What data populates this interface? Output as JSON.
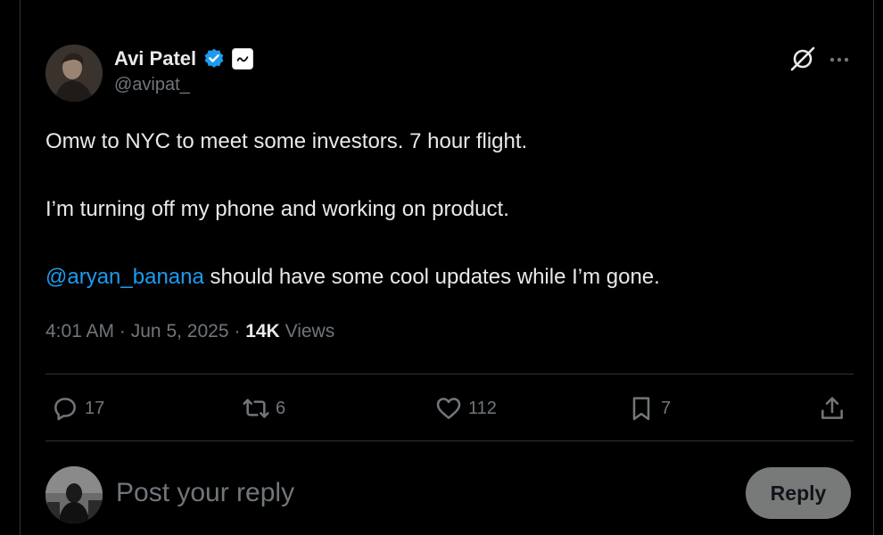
{
  "author": {
    "display_name": "Avi Patel",
    "handle": "@avipat_",
    "verified_color": "#1d9bf0"
  },
  "tweet": {
    "line1": "Omw to NYC to meet some investors. 7 hour flight.",
    "line2": "I’m turning off my phone and working on product.",
    "mention": "@aryan_banana",
    "line3_rest": " should have some cool updates while I’m gone.",
    "time": "4:01 AM",
    "date": "Jun 5, 2025",
    "separator": "·",
    "views_count": "14K",
    "views_label": "Views"
  },
  "actions": {
    "replies": "17",
    "reposts": "6",
    "likes": "112",
    "bookmarks": "7"
  },
  "reply_box": {
    "placeholder": "Post your reply",
    "button_label": "Reply"
  },
  "icons": {
    "header": [
      "verified-icon",
      "affiliate-badge-icon",
      "grok-icon",
      "more-icon"
    ],
    "actions": [
      "reply-icon",
      "repost-icon",
      "like-icon",
      "bookmark-icon",
      "share-icon"
    ]
  },
  "colors": {
    "background": "#000000",
    "text": "#e7e9ea",
    "secondary_text": "#71767b",
    "link": "#1d9bf0",
    "divider": "#2f3336",
    "reply_button_bg": "#787a7a"
  }
}
